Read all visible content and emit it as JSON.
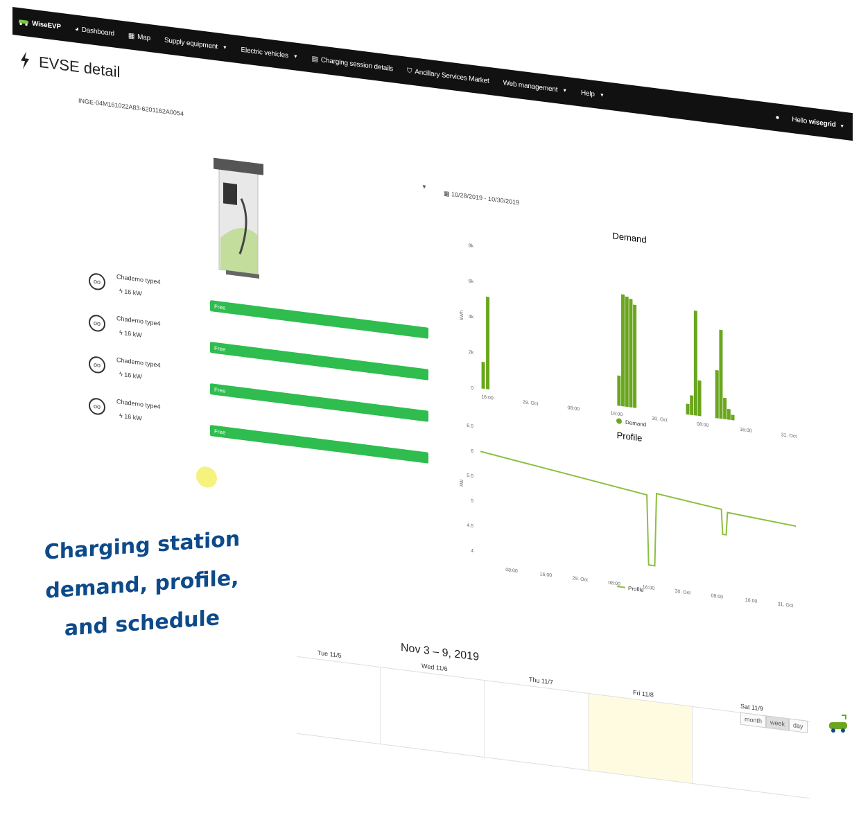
{
  "navbar": {
    "brand": "WiseEVP",
    "items": [
      {
        "label": "Dashboard",
        "icon": "dashboard-icon",
        "dropdown": false
      },
      {
        "label": "Map",
        "icon": "map-icon",
        "dropdown": false
      },
      {
        "label": "Supply equipment",
        "icon": "",
        "dropdown": true
      },
      {
        "label": "Electric vehicles",
        "icon": "",
        "dropdown": true
      },
      {
        "label": "Charging session details",
        "icon": "calculator-icon",
        "dropdown": false
      },
      {
        "label": "Ancillary Services Market",
        "icon": "shield-icon",
        "dropdown": false
      },
      {
        "label": "Web management",
        "icon": "",
        "dropdown": true
      },
      {
        "label": "Help",
        "icon": "",
        "dropdown": true
      }
    ],
    "greeting_prefix": "Hello",
    "username": "wisegrid"
  },
  "page": {
    "title": "EVSE detail",
    "evse_id": "INGE-04M161022A83-6201162A0054"
  },
  "connectors": [
    {
      "type": "Chademo type4",
      "power": "16 kW",
      "status": "Free"
    },
    {
      "type": "Chademo type4",
      "power": "16 kW",
      "status": "Free"
    },
    {
      "type": "Chademo type4",
      "power": "16 kW",
      "status": "Free"
    },
    {
      "type": "Chademo type4",
      "power": "16 kW",
      "status": "Free"
    }
  ],
  "date_range": "10/28/2019 - 10/30/2019",
  "colors": {
    "accent_green": "#2ebd4e",
    "chart_green": "#6aa61e",
    "profile_line": "#8cbf3f",
    "navbar": "#111111",
    "overlay_blue": "#0d4a8a"
  },
  "chart_data": [
    {
      "type": "bar",
      "title": "Demand",
      "ylabel": "kWh",
      "ylim": [
        0,
        8000
      ],
      "yticks": [
        "0",
        "2k",
        "4k",
        "6k",
        "8k"
      ],
      "xticks": [
        "16:00",
        "29. Oct",
        "08:00",
        "16:00",
        "30. Oct",
        "08:00",
        "16:00",
        "31. Oct"
      ],
      "xlim": [
        16,
        72
      ],
      "legend": "Demand",
      "series": [
        {
          "name": "Demand",
          "points": [
            {
              "x": 16.5,
              "y": 1500
            },
            {
              "x": 17.3,
              "y": 5200
            },
            {
              "x": 40.6,
              "y": 1700
            },
            {
              "x": 41.3,
              "y": 6300
            },
            {
              "x": 42.0,
              "y": 6200
            },
            {
              "x": 42.7,
              "y": 6100
            },
            {
              "x": 43.4,
              "y": 5800
            },
            {
              "x": 52.8,
              "y": 600
            },
            {
              "x": 53.5,
              "y": 1100
            },
            {
              "x": 54.2,
              "y": 5900
            },
            {
              "x": 54.9,
              "y": 2000
            },
            {
              "x": 58.0,
              "y": 2700
            },
            {
              "x": 58.7,
              "y": 5000
            },
            {
              "x": 59.4,
              "y": 1200
            },
            {
              "x": 60.1,
              "y": 600
            },
            {
              "x": 60.8,
              "y": 300
            }
          ]
        }
      ]
    },
    {
      "type": "line",
      "title": "Profile",
      "ylabel": "kW",
      "ylim": [
        4,
        6.5
      ],
      "yticks": [
        "4",
        "4.5",
        "5",
        "5.5",
        "6",
        "6.5"
      ],
      "xticks": [
        "08:00",
        "16:00",
        "29. Oct",
        "08:00",
        "16:00",
        "30. Oct",
        "08:00",
        "16:00",
        "31. Oct"
      ],
      "xlim": [
        0,
        72
      ],
      "legend": "Profile",
      "series": [
        {
          "name": "Profile",
          "points": [
            [
              0,
              6
            ],
            [
              38.0,
              5.55
            ],
            [
              38.4,
              4.15
            ],
            [
              39.8,
              4.15
            ],
            [
              40.2,
              5.6
            ],
            [
              55.0,
              5.45
            ],
            [
              55.3,
              4.95
            ],
            [
              56.1,
              4.95
            ],
            [
              56.4,
              5.4
            ],
            [
              72,
              5.3
            ]
          ]
        }
      ]
    }
  ],
  "overlay": {
    "lines": [
      "Charging station",
      "demand, profile,",
      "and schedule"
    ]
  },
  "calendar": {
    "title": "Nov 3 – 9, 2019",
    "days": [
      "Tue 11/5",
      "Wed 11/6",
      "Thu 11/7",
      "Fri 11/8",
      "Sat 11/9"
    ],
    "views": [
      "month",
      "week",
      "day"
    ],
    "active_view": "week"
  }
}
